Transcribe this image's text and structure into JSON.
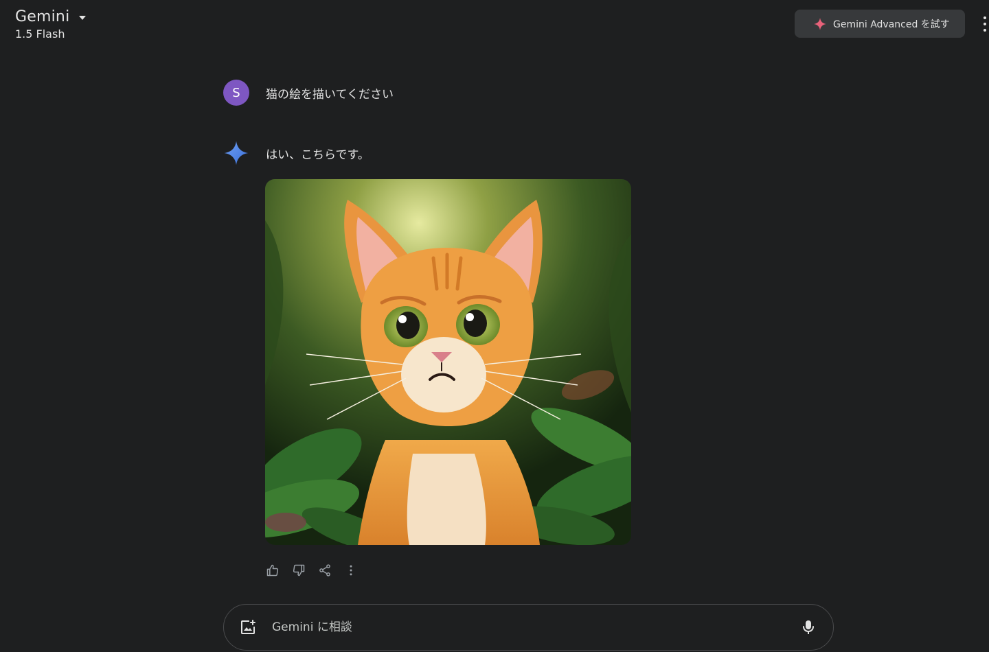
{
  "header": {
    "app_title": "Gemini",
    "model_name": "1.5 Flash",
    "advanced_button_label": "Gemini Advanced を試す"
  },
  "conversation": {
    "user": {
      "avatar_initial": "S",
      "avatar_color": "#7e57c2",
      "message": "猫の絵を描いてください"
    },
    "model": {
      "message": "はい、こちらです。",
      "image_subject": "orange cartoon cat in a jungle"
    }
  },
  "actions": {
    "icons": [
      "thumbs-up-icon",
      "thumbs-down-icon",
      "share-icon",
      "more-options-icon"
    ]
  },
  "input": {
    "placeholder": "Gemini に相談"
  },
  "colors": {
    "background": "#1e1f20",
    "advanced_button_bg": "#37393b",
    "gemini_spark": "#4f8ef7",
    "advanced_spark": "#e8627a"
  }
}
